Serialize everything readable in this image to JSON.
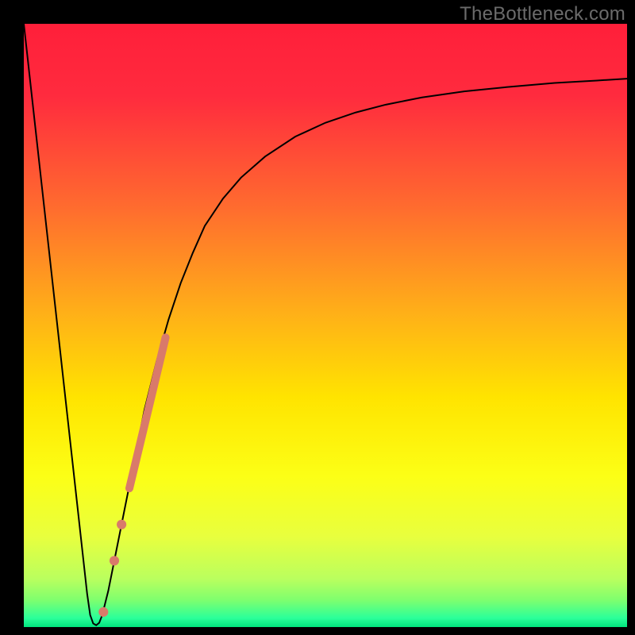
{
  "watermark": "TheBottleneck.com",
  "chart_data": {
    "type": "line",
    "title": "",
    "xlabel": "",
    "ylabel": "",
    "xlim": [
      0,
      100
    ],
    "ylim": [
      0,
      100
    ],
    "grid": false,
    "gradient_stops": [
      {
        "offset": 0.0,
        "color": "#ff1f3a"
      },
      {
        "offset": 0.12,
        "color": "#ff2b3e"
      },
      {
        "offset": 0.3,
        "color": "#ff6a2f"
      },
      {
        "offset": 0.48,
        "color": "#ffb018"
      },
      {
        "offset": 0.62,
        "color": "#ffe400"
      },
      {
        "offset": 0.75,
        "color": "#fcff16"
      },
      {
        "offset": 0.85,
        "color": "#e8ff3e"
      },
      {
        "offset": 0.92,
        "color": "#baff5e"
      },
      {
        "offset": 0.955,
        "color": "#7fff6e"
      },
      {
        "offset": 0.985,
        "color": "#2bff9a"
      },
      {
        "offset": 1.0,
        "color": "#00e57e"
      }
    ],
    "series": [
      {
        "name": "curve",
        "color": "#000000",
        "stroke_width": 2,
        "x": [
          0.0,
          1.0,
          2.0,
          3.0,
          4.0,
          5.0,
          6.0,
          7.0,
          8.0,
          9.0,
          10.0,
          10.5,
          11.0,
          11.5,
          12.0,
          12.5,
          13.0,
          14.0,
          15.0,
          16.0,
          17.0,
          18.0,
          19.0,
          20.0,
          22.0,
          24.0,
          26.0,
          28.0,
          30.0,
          33.0,
          36.0,
          40.0,
          45.0,
          50.0,
          55.0,
          60.0,
          66.0,
          73.0,
          80.0,
          88.0,
          95.0,
          100.0
        ],
        "y": [
          100.0,
          91.0,
          82.0,
          73.0,
          64.0,
          55.0,
          46.0,
          37.0,
          28.0,
          19.0,
          10.0,
          5.5,
          2.0,
          0.6,
          0.3,
          0.7,
          2.0,
          6.0,
          11.0,
          16.0,
          21.0,
          26.0,
          31.0,
          36.0,
          44.0,
          51.0,
          57.0,
          62.0,
          66.5,
          71.0,
          74.5,
          78.0,
          81.3,
          83.6,
          85.3,
          86.6,
          87.8,
          88.8,
          89.5,
          90.2,
          90.6,
          90.9
        ]
      },
      {
        "name": "highlight-segment",
        "color": "#d97a6a",
        "stroke_width": 10,
        "x": [
          17.5,
          23.5
        ],
        "y": [
          23.0,
          48.0
        ]
      }
    ],
    "highlight_dots": {
      "color": "#d97a6a",
      "radius": 6,
      "points": [
        {
          "x": 15.0,
          "y": 11.0
        },
        {
          "x": 16.2,
          "y": 17.0
        },
        {
          "x": 13.2,
          "y": 2.5
        }
      ]
    }
  }
}
